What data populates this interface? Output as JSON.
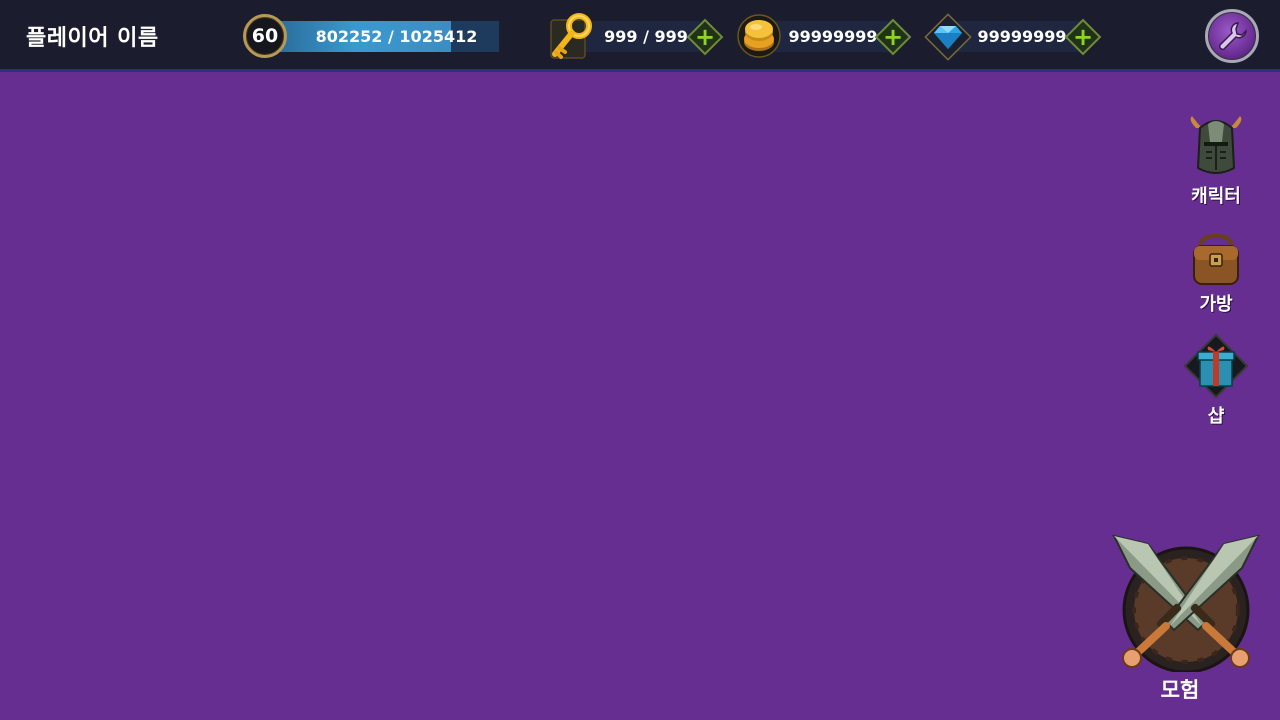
{
  "header": {
    "player_name": "플레이어 이름",
    "level": "60",
    "xp_text": "802252 / 1025412",
    "xp_current": 802252,
    "xp_max": 1025412
  },
  "resources": {
    "keys": {
      "text": "999 / 999",
      "icon": "key-icon"
    },
    "gold": {
      "text": "99999999",
      "icon": "gold-coin-icon"
    },
    "gems": {
      "text": "99999999",
      "icon": "diamond-icon"
    }
  },
  "sidebar": {
    "items": [
      {
        "label": "캐릭터",
        "icon": "knight-helmet-icon"
      },
      {
        "label": "가방",
        "icon": "backpack-icon"
      },
      {
        "label": "샵",
        "icon": "gift-box-icon"
      }
    ]
  },
  "adventure": {
    "label": "모험",
    "icon": "crossed-swords-shield-icon"
  },
  "colors": {
    "background": "#662e91",
    "topbar": "#1b1c2e",
    "xp_fill": "#3a9ad0",
    "plus": "#8fd22a"
  }
}
